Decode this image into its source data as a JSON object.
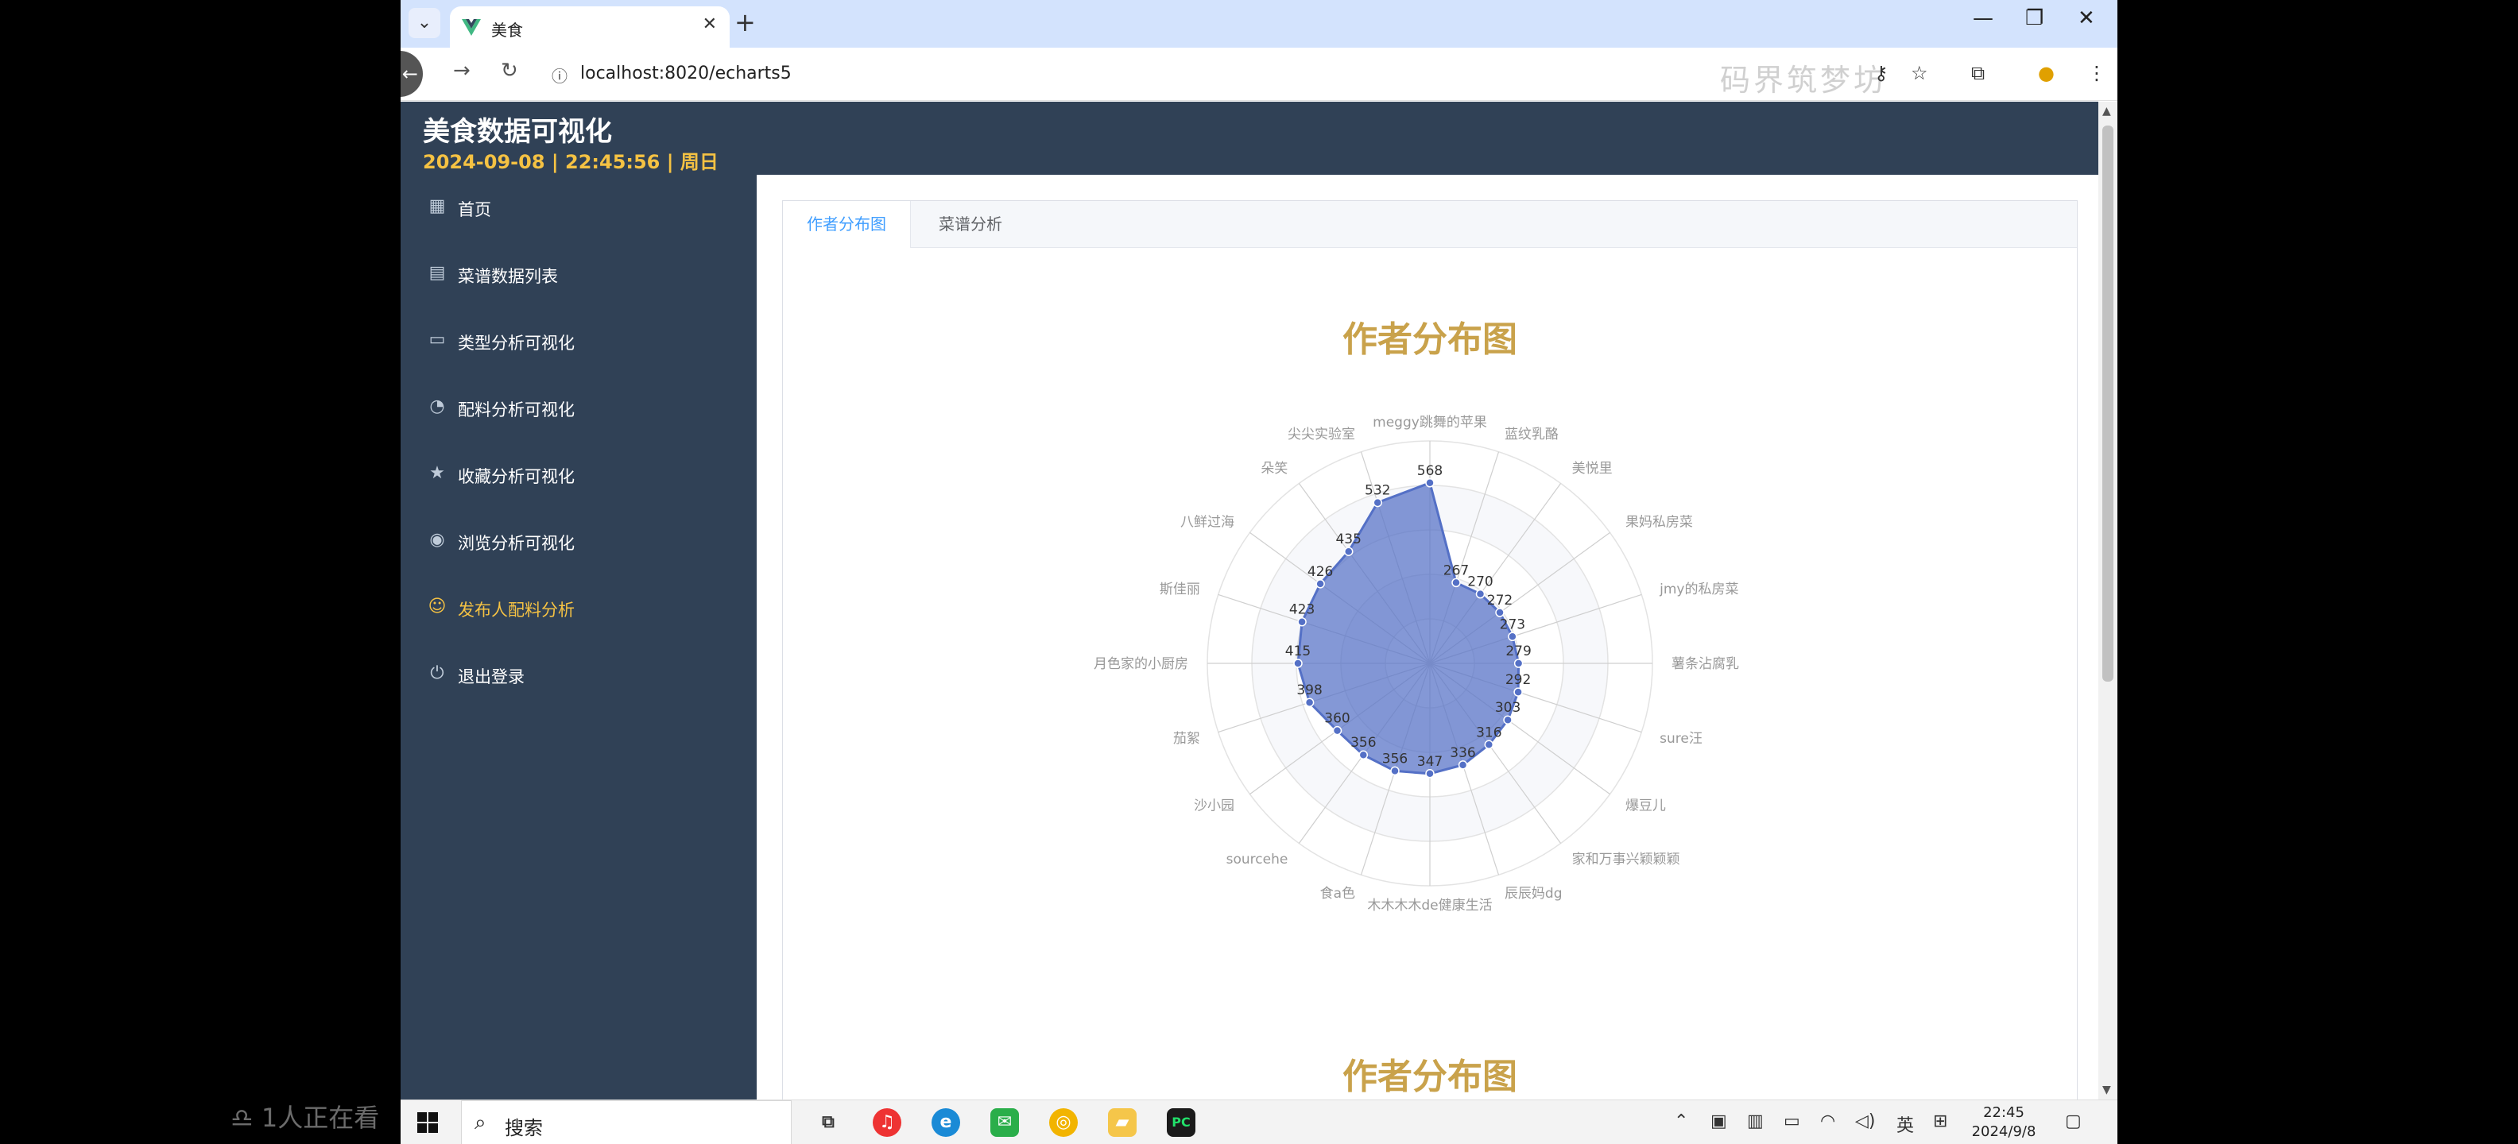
{
  "browser": {
    "tab_title": "美食",
    "url": "localhost:8020/echarts5",
    "watermark": "码界筑梦坊"
  },
  "app": {
    "title": "美食数据可视化",
    "datetime": "2024-09-08 | 22:45:56 | 周日"
  },
  "sidebar": {
    "items": [
      {
        "label": "首页",
        "icon": "grid-icon"
      },
      {
        "label": "菜谱数据列表",
        "icon": "document-icon"
      },
      {
        "label": "类型分析可视化",
        "icon": "monitor-icon"
      },
      {
        "label": "配料分析可视化",
        "icon": "pie-icon"
      },
      {
        "label": "收藏分析可视化",
        "icon": "star-icon"
      },
      {
        "label": "浏览分析可视化",
        "icon": "eye-icon"
      },
      {
        "label": "发布人配料分析",
        "icon": "user-icon",
        "active": true
      },
      {
        "label": "退出登录",
        "icon": "power-icon"
      }
    ]
  },
  "tabs": [
    "作者分布图",
    "菜谱分析"
  ],
  "chart_titles": [
    "作者分布图",
    "作者分布图"
  ],
  "chart_data": {
    "type": "radar",
    "title": "作者分布图",
    "max": 700,
    "color": "#5470c6",
    "indicators": [
      {
        "name": "meggy跳舞的苹果",
        "value": 568
      },
      {
        "name": "蓝纹乳酪",
        "value": 267
      },
      {
        "name": "美悦里",
        "value": 270
      },
      {
        "name": "果妈私房菜",
        "value": 272
      },
      {
        "name": "jmy的私房菜",
        "value": 273
      },
      {
        "name": "薯条沾腐乳",
        "value": 279
      },
      {
        "name": "sure汪",
        "value": 292
      },
      {
        "name": "爆豆儿",
        "value": 303
      },
      {
        "name": "家和万事兴颖颖颖",
        "value": 316
      },
      {
        "name": "辰辰妈dg",
        "value": 336
      },
      {
        "name": "木木木木de健康生活",
        "value": 347
      },
      {
        "name": "食a色",
        "value": 356
      },
      {
        "name": "sourcehe",
        "value": 356
      },
      {
        "name": "沙小园",
        "value": 360
      },
      {
        "name": "茄絮",
        "value": 398
      },
      {
        "name": "月色家的小厨房",
        "value": 415
      },
      {
        "name": "斯佳丽",
        "value": 423
      },
      {
        "name": "八鲜过海",
        "value": 426
      },
      {
        "name": "朵笑",
        "value": 435
      },
      {
        "name": "尖尖实验室",
        "value": 532
      }
    ]
  },
  "taskbar": {
    "search_label": "搜索",
    "ime": "英",
    "time": "22:45",
    "date": "2024/9/8"
  },
  "overlay": {
    "viewer_note": "1人正在看"
  }
}
